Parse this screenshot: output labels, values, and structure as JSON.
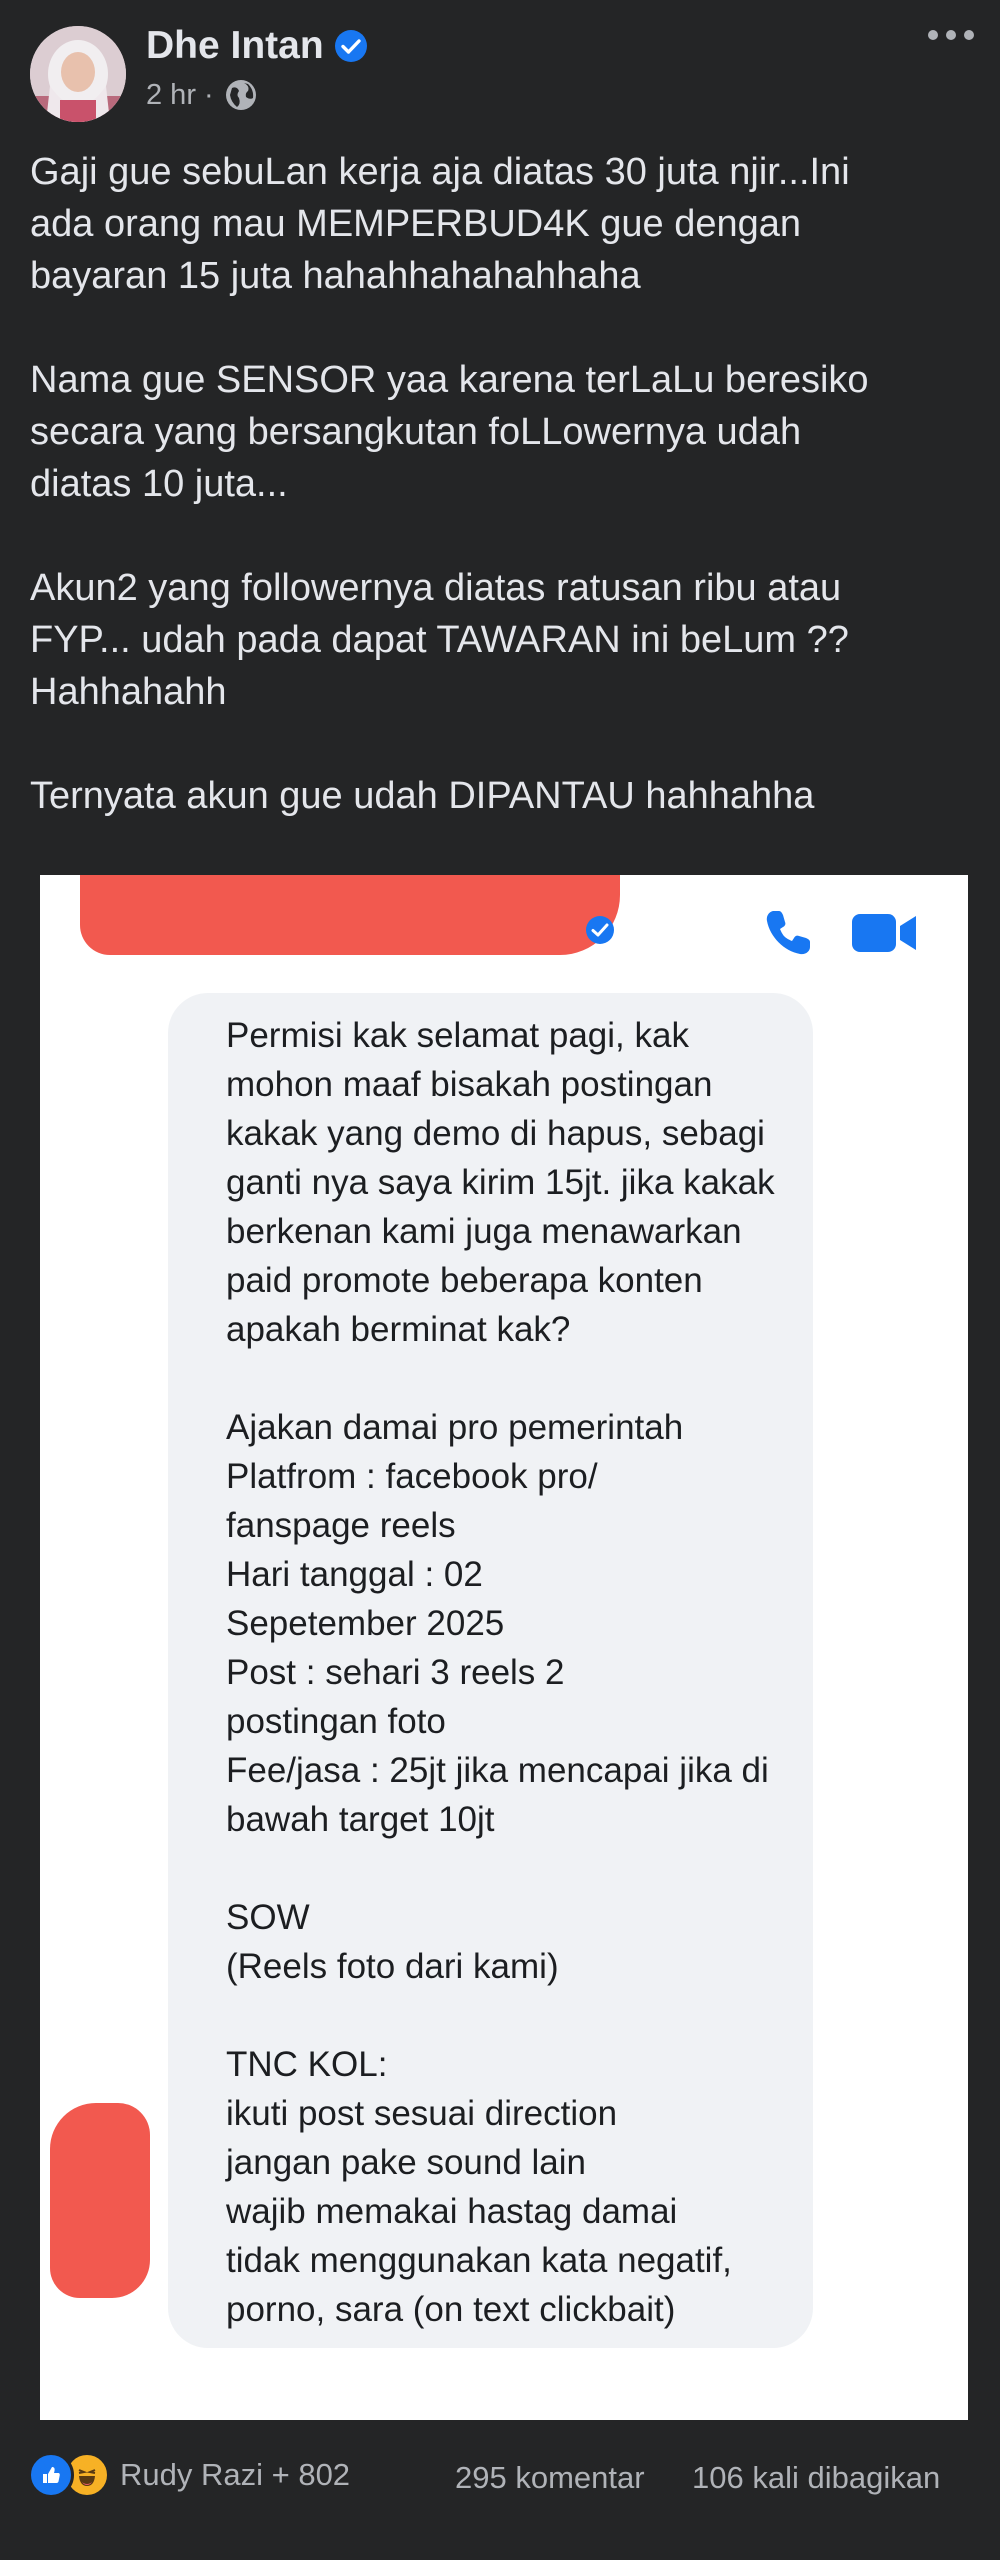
{
  "post": {
    "author": "Dhe Intan",
    "time": "2 hr ·",
    "verified_icon": "verified-badge-icon",
    "privacy_icon": "globe-icon",
    "body": "Gaji gue sebuLan kerja aja diatas 30 juta njir...Ini\nada orang mau MEMPERBUD4K gue dengan\nbayaran 15 juta hahahhahahahhaha\n\nNama gue SENSOR yaa karena terLaLu beresiko\nsecara yang bersangkutan foLLowernya udah\ndiatas 10 juta...\n\nAkun2 yang followernya diatas ratusan ribu atau\nFYP... udah pada dapat TAWARAN ini beLum ??\nHahhahahh\n\nTernyata akun gue udah DIPANTAU hahhahha"
  },
  "screenshot": {
    "message": "Permisi kak selamat pagi, kak\nmohon maaf bisakah postingan\nkakak yang demo di hapus, sebagi\nganti nya saya kirim 15jt. jika kakak\nberkenan kami juga menawarkan\npaid promote beberapa konten\napakah berminat kak?\n\nAjakan damai pro pemerintah\nPlatfrom : facebook pro/\nfanspage reels\nHari tanggal : 02\nSepetember 2025\nPost : sehari 3 reels 2\npostingan foto\nFee/jasa : 25jt jika mencapai jika di\nbawah target 10jt\n\nSOW\n(Reels foto dari kami)\n\nTNC KOL:\nikuti post sesuai direction\njangan pake sound lain\nwajib memakai hastag damai\ntidak menggunakan kata negatif,\nporno, sara (on text clickbait)",
    "accent_blue": "#1877f2",
    "redaction_color": "#f2594f"
  },
  "footer": {
    "reactors": "Rudy Razi + 802",
    "comments": "295 komentar",
    "shares": "106 kali dibagikan",
    "reaction_icons": [
      "like-icon",
      "haha-icon"
    ]
  },
  "colors": {
    "background": "#242526",
    "text": "#e4e6eb",
    "muted": "#b0b3b8"
  }
}
